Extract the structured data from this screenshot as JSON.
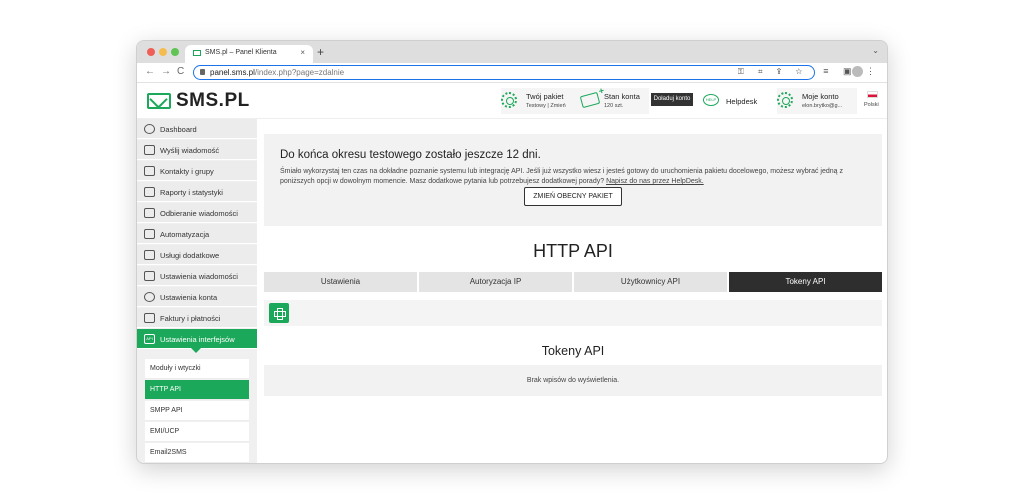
{
  "browser": {
    "tab_title": "SMS.pl – Panel Klienta",
    "tab_close": "×",
    "new_tab": "+",
    "menu": "⌄",
    "back": "←",
    "forward": "→",
    "reload": "C",
    "url_host": "panel.sms.pl",
    "url_path": "/index.php?page=zdalnie",
    "url_icons": "⚿ ⌗ ⇪ ☆",
    "toolbar_right": "≡ ▣ ⋮"
  },
  "header": {
    "logo_text": "SMS.PL",
    "package_title": "Twój pakiet",
    "package_sub": "Testowy | Zmień",
    "balance_title": "Stan konta",
    "balance_sub": "120 szt.",
    "topup_label": "Doładuj konto",
    "help_icon_text": "HELP",
    "helpdesk_label": "Helpdesk",
    "account_title": "Moje konto",
    "account_sub": "elon.brytko@g...",
    "language": "Polski"
  },
  "sidebar": {
    "items": [
      {
        "label": "Dashboard"
      },
      {
        "label": "Wyślij wiadomość"
      },
      {
        "label": "Kontakty i grupy"
      },
      {
        "label": "Raporty i statystyki"
      },
      {
        "label": "Odbieranie wiadomości"
      },
      {
        "label": "Automatyzacja"
      },
      {
        "label": "Usługi dodatkowe"
      },
      {
        "label": "Ustawienia wiadomości"
      },
      {
        "label": "Ustawienia konta"
      },
      {
        "label": "Faktury i płatności"
      },
      {
        "label": "Ustawienia interfejsów",
        "icon_text": "API"
      }
    ],
    "subitems": [
      {
        "label": "Moduły i wtyczki"
      },
      {
        "label": "HTTP API"
      },
      {
        "label": "SMPP API"
      },
      {
        "label": "EMI/UCP"
      },
      {
        "label": "Email2SMS"
      }
    ]
  },
  "notice": {
    "title": "Do końca okresu testowego zostało jeszcze 12 dni.",
    "text": "Śmiało wykorzystaj ten czas na dokładne poznanie systemu lub integrację API. Jeśli już wszystko wiesz i jesteś gotowy do uruchomienia pakietu docelowego, możesz wybrać jedną z poniższych opcji w dowolnym momencie. Masz dodatkowe pytania lub potrzebujesz dodatkowej porady? ",
    "link": "Napisz do nas przez HelpDesk.",
    "button": "ZMIEŃ OBECNY PAKIET"
  },
  "main": {
    "title": "HTTP API",
    "tabs": [
      {
        "label": "Ustawienia"
      },
      {
        "label": "Autoryzacja IP"
      },
      {
        "label": "Użytkownicy API"
      },
      {
        "label": "Tokeny API"
      }
    ],
    "list_title": "Tokeny API",
    "empty_text": "Brak wpisów do wyświetlenia."
  }
}
